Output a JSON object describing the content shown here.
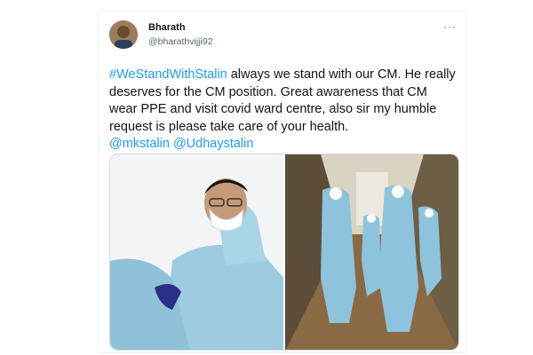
{
  "tweet": {
    "author_name": "Bharath",
    "author_handle": "@bharathvijji92",
    "more_icon": "more-icon",
    "text": {
      "hashtag": "#WeStandWithStalin",
      "body": " always we stand with our CM. He really deserves for the CM position. Great awareness that CM wear PPE and visit covid ward centre, also sir my humble request is please take care of your health.",
      "mention_1": "@mkstalin",
      "mention_2": "@Udhaystalin"
    },
    "media": [
      {
        "name": "photo-cm-ppe-closeup"
      },
      {
        "name": "photo-covid-ward-visit"
      }
    ]
  },
  "colors": {
    "link": "#1d9bf0",
    "ppe": "#9ecbe0",
    "text": "#0f1419",
    "secondary": "#536471"
  }
}
